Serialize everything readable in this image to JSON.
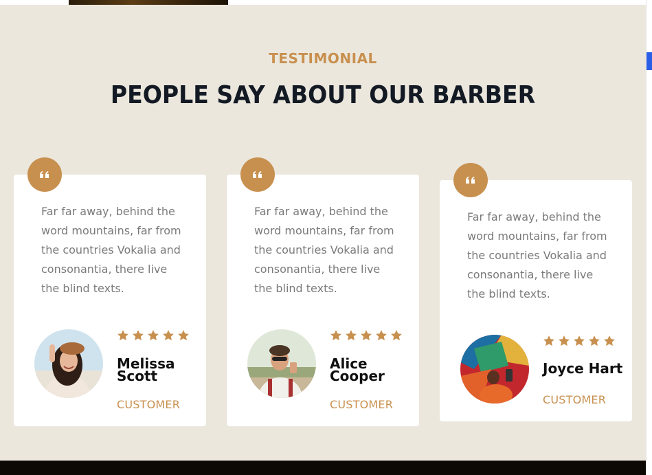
{
  "section": {
    "eyebrow": "TESTIMONIAL",
    "heading": "PEOPLE SAY ABOUT OUR BARBER"
  },
  "colors": {
    "accent": "#c8904f",
    "section_background": "#ebe7dd",
    "heading": "#131a24",
    "body_text": "#7a7a7a",
    "footer": "#0c0804",
    "scroll_thumb": "#2a5ee6"
  },
  "testimonials": [
    {
      "quote": "Far far away, behind the word mountains, far from the countries Vokalia and consonantia, there live the blind texts.",
      "rating": 5,
      "name_line1": "Melissa",
      "name_line2": "Scott",
      "role": "CUSTOMER",
      "icon": "quote-icon"
    },
    {
      "quote": "Far far away, behind the word mountains, far from the countries Vokalia and consonantia, there live the blind texts.",
      "rating": 5,
      "name_line1": "Alice",
      "name_line2": "Cooper",
      "role": "CUSTOMER",
      "icon": "quote-icon"
    },
    {
      "quote": "Far far away, behind the word mountains, far from the countries Vokalia and consonantia, there live the blind texts.",
      "rating": 5,
      "name_line1": "Joyce Hart",
      "name_line2": "",
      "role": "CUSTOMER",
      "icon": "quote-icon"
    }
  ]
}
